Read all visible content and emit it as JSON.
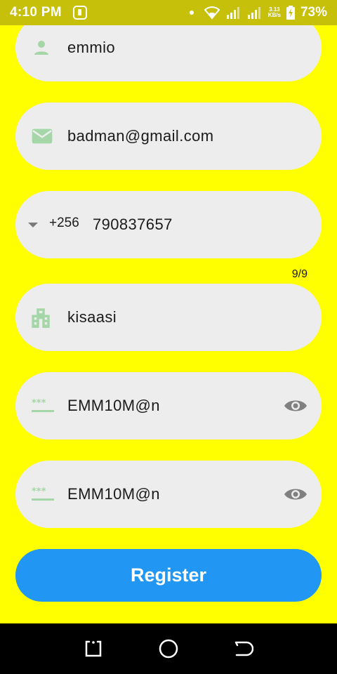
{
  "status_bar": {
    "time": "4:10 PM",
    "net_speed_value": "3.13",
    "net_speed_unit": "KB/s",
    "battery_percent": "73%"
  },
  "form": {
    "name": {
      "value": "emmio",
      "icon": "person-icon"
    },
    "email": {
      "value": "badman@gmail.com",
      "icon": "mail-icon"
    },
    "phone": {
      "country_code": "+256",
      "number": "790837657",
      "counter": "9/9"
    },
    "city": {
      "value": "kisaasi",
      "icon": "location-city-icon"
    },
    "password": {
      "value": "EMM10M@n",
      "icon": "password-icon",
      "trailing_icon": "eye-icon"
    },
    "confirm_password": {
      "value": "EMM10M@n",
      "icon": "password-icon",
      "trailing_icon": "eye-icon"
    },
    "register_label": "Register"
  },
  "colors": {
    "background": "#ffff00",
    "field_fill": "#ededed",
    "icon_green": "#a5d6a7",
    "button_blue": "#2196f3"
  }
}
